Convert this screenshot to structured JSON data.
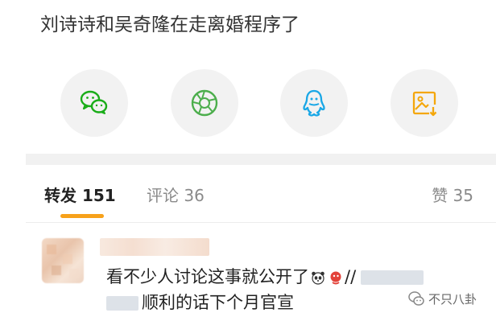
{
  "post": {
    "headline": "刘诗诗和吴奇隆在走离婚程序了"
  },
  "share": {
    "items": [
      {
        "icon": "wechat-icon",
        "color": "#1aad19"
      },
      {
        "icon": "moments-icon",
        "color": "#4cae4c"
      },
      {
        "icon": "qq-icon",
        "color": "#19a7e6"
      },
      {
        "icon": "save-image-icon",
        "color": "#f4a70b"
      }
    ]
  },
  "tabs": {
    "forward": "转发 151",
    "comment": "评论 36",
    "like": "赞 35"
  },
  "comment": {
    "text_part1": "看不少人讨论这事就公开了",
    "separator": "//",
    "text_part2": "顺利的话下个月官宣"
  },
  "watermark": {
    "text": "不只八卦"
  },
  "colors": {
    "accent": "#f7a11a",
    "tab_inactive": "#8a8a8a"
  }
}
